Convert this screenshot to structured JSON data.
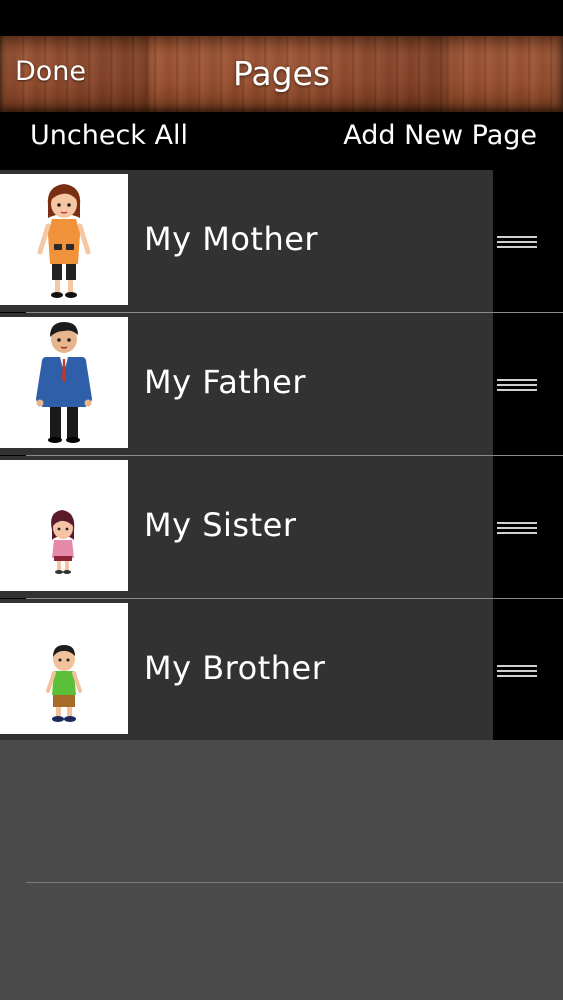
{
  "nav": {
    "done_label": "Done",
    "title": "Pages"
  },
  "toolbar": {
    "uncheck_all_label": "Uncheck All",
    "add_page_label": "Add New Page"
  },
  "pages": [
    {
      "label": "My Mother",
      "thumbnail_icon": "mother-figure-icon"
    },
    {
      "label": "My Father",
      "thumbnail_icon": "father-figure-icon"
    },
    {
      "label": "My Sister",
      "thumbnail_icon": "sister-figure-icon"
    },
    {
      "label": "My Brother",
      "thumbnail_icon": "brother-figure-icon"
    }
  ],
  "colors": {
    "row_bg": "#323232",
    "empty_bg": "#4a4a4a",
    "nav_wood": "#9a5233"
  }
}
